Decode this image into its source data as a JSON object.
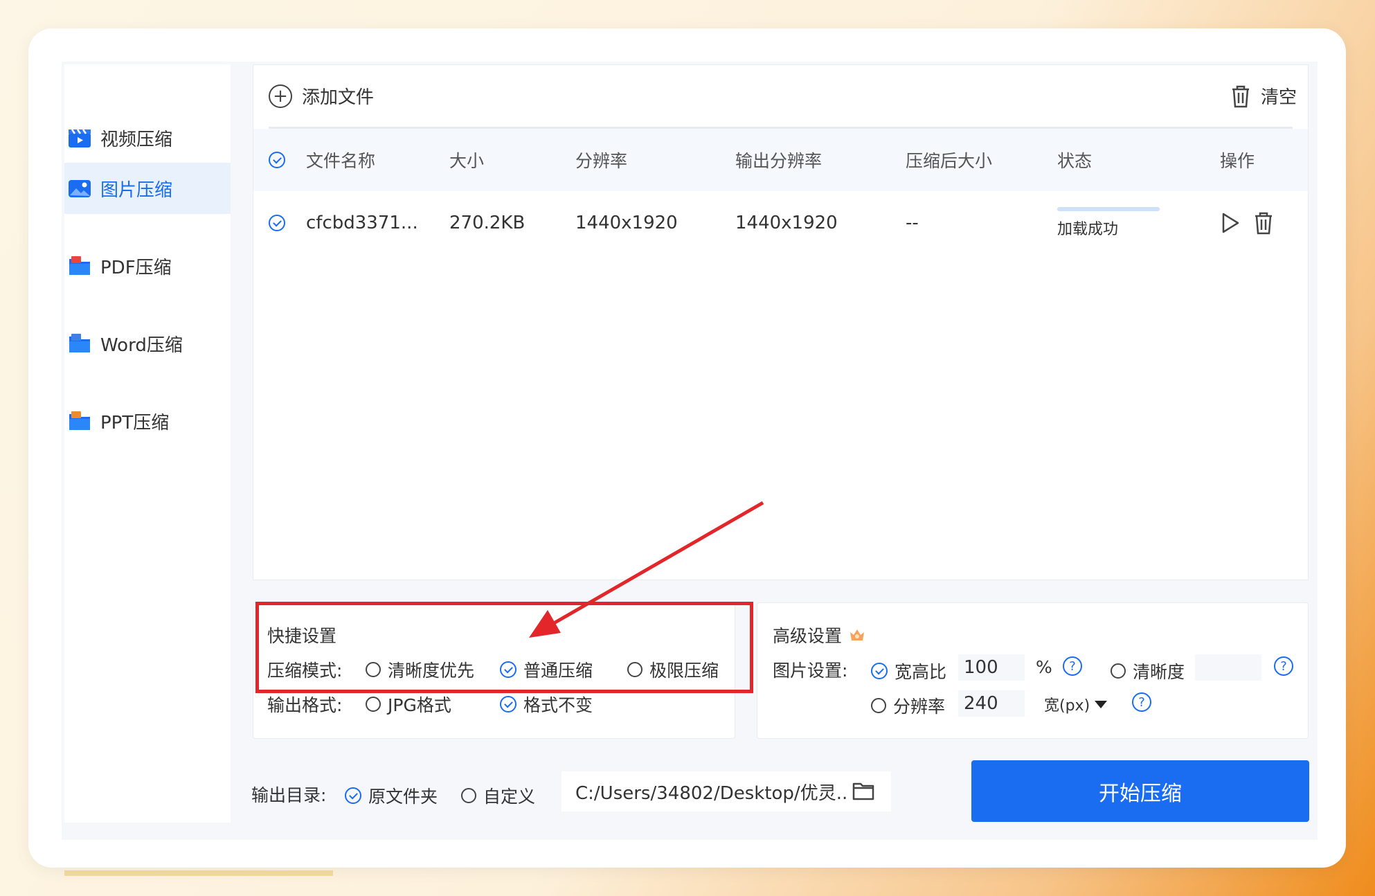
{
  "sidebar": {
    "items": [
      {
        "label": "视频压缩",
        "icon": "video-clapper-icon",
        "active": false
      },
      {
        "label": "图片压缩",
        "icon": "image-icon",
        "active": true
      },
      {
        "label": "PDF压缩",
        "icon": "pdf-folder-icon",
        "active": false
      },
      {
        "label": "Word压缩",
        "icon": "word-folder-icon",
        "active": false
      },
      {
        "label": "PPT压缩",
        "icon": "ppt-folder-icon",
        "active": false
      }
    ]
  },
  "toolbar": {
    "add_file_label": "添加文件",
    "clear_label": "清空"
  },
  "table": {
    "headers": [
      "文件名称",
      "大小",
      "分辨率",
      "输出分辨率",
      "压缩后大小",
      "状态",
      "操作"
    ],
    "rows": [
      {
        "name": "cfcbd3371...",
        "size": "270.2KB",
        "resolution": "1440x1920",
        "output_resolution": "1440x1920",
        "compressed_size": "--",
        "status": "加载成功"
      }
    ]
  },
  "quick_settings": {
    "title": "快捷设置",
    "mode_label": "压缩模式:",
    "mode_options": [
      {
        "label": "清晰度优先",
        "checked": false
      },
      {
        "label": "普通压缩",
        "checked": true
      },
      {
        "label": "极限压缩",
        "checked": false
      }
    ],
    "format_label": "输出格式:",
    "format_options": [
      {
        "label": "JPG格式",
        "checked": false
      },
      {
        "label": "格式不变",
        "checked": true
      }
    ]
  },
  "advanced_settings": {
    "title": "高级设置",
    "image_label": "图片设置:",
    "aspect_label": "宽高比",
    "aspect_value": "100",
    "aspect_unit": "%",
    "clarity_label": "清晰度",
    "clarity_value": "",
    "resolution_label": "分辨率",
    "resolution_value": "240",
    "resolution_unit": "宽(px)",
    "help_glyph": "?"
  },
  "output": {
    "label": "输出目录:",
    "options": [
      {
        "label": "原文件夹",
        "checked": true
      },
      {
        "label": "自定义",
        "checked": false
      }
    ],
    "path": "C:/Users/34802/Desktop/优灵.."
  },
  "start_button_label": "开始压缩",
  "colors": {
    "accent": "#1a6cf0",
    "highlight": "#e3262a",
    "active_bg": "#e9f1fd"
  }
}
